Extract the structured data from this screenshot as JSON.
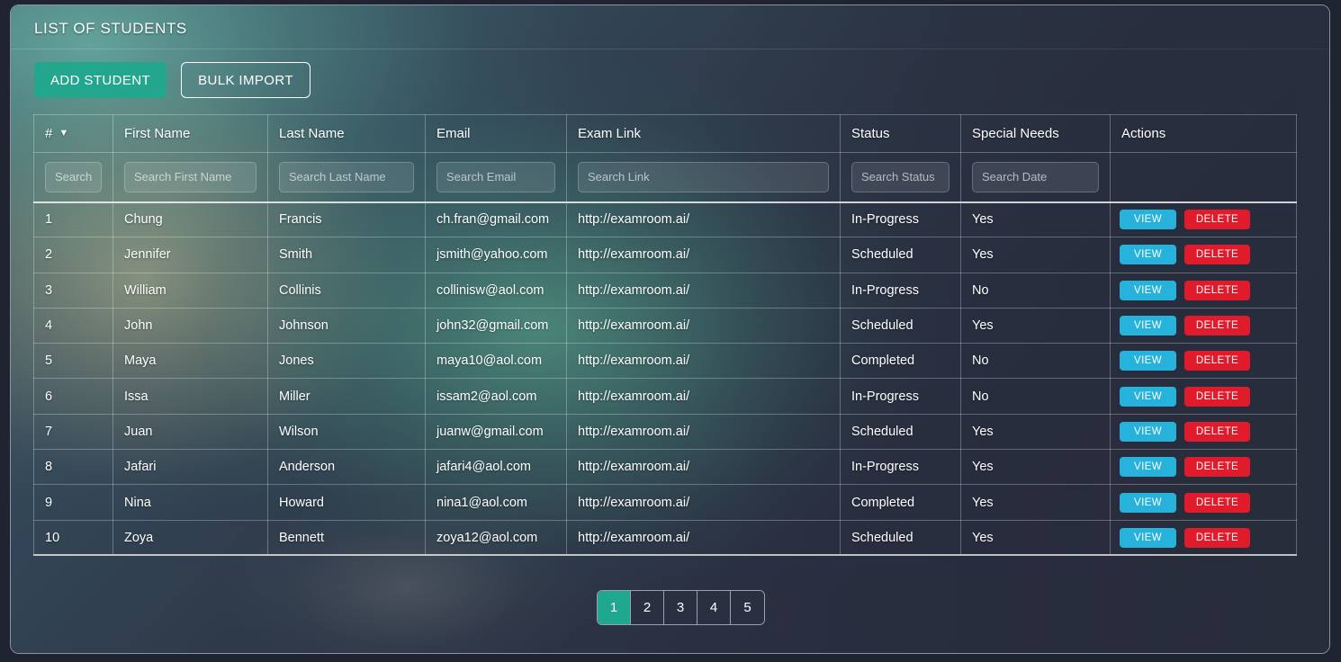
{
  "panel": {
    "title": "LIST OF STUDENTS"
  },
  "toolbar": {
    "add_student_label": "ADD STUDENT",
    "bulk_import_label": "BULK IMPORT"
  },
  "colors": {
    "primary_teal": "#22a68d",
    "view_blue": "#27b2db",
    "delete_red": "#e01b2c",
    "panel_dark": "#2b3143",
    "active_page": "#1fa78f"
  },
  "table": {
    "columns": [
      {
        "key": "num",
        "label": "#",
        "sort_icon": "chevron-down-icon",
        "sorted": true
      },
      {
        "key": "first",
        "label": "First Name"
      },
      {
        "key": "last",
        "label": "Last Name"
      },
      {
        "key": "email",
        "label": "Email"
      },
      {
        "key": "link",
        "label": "Exam Link"
      },
      {
        "key": "status",
        "label": "Status"
      },
      {
        "key": "needs",
        "label": "Special Needs"
      },
      {
        "key": "actions",
        "label": "Actions"
      }
    ],
    "search_row": [
      {
        "name": "search-num-input",
        "placeholder": "Search",
        "value": ""
      },
      {
        "name": "search-first-input",
        "placeholder": "Search First Name",
        "value": ""
      },
      {
        "name": "search-last-input",
        "placeholder": "Search Last Name",
        "value": ""
      },
      {
        "name": "search-email-input",
        "placeholder": "Search Email",
        "value": ""
      },
      {
        "name": "search-link-input",
        "placeholder": "Search Link",
        "value": ""
      },
      {
        "name": "search-status-input",
        "placeholder": "Search Status",
        "value": ""
      },
      {
        "name": "search-date-input",
        "placeholder": "Search Date",
        "value": ""
      }
    ],
    "row_actions": {
      "view_label": "VIEW",
      "delete_label": "DELETE"
    },
    "rows": [
      {
        "num": "1",
        "first": "Chung",
        "last": "Francis",
        "email": "ch.fran@gmail.com",
        "link": "http://examroom.ai/",
        "status": "In-Progress",
        "needs": "Yes"
      },
      {
        "num": "2",
        "first": "Jennifer",
        "last": "Smith",
        "email": "jsmith@yahoo.com",
        "link": "http://examroom.ai/",
        "status": "Scheduled",
        "needs": "Yes"
      },
      {
        "num": "3",
        "first": "William",
        "last": "Collinis",
        "email": "collinisw@aol.com",
        "link": "http://examroom.ai/",
        "status": "In-Progress",
        "needs": "No"
      },
      {
        "num": "4",
        "first": "John",
        "last": "Johnson",
        "email": "john32@gmail.com",
        "link": "http://examroom.ai/",
        "status": "Scheduled",
        "needs": "Yes"
      },
      {
        "num": "5",
        "first": "Maya",
        "last": "Jones",
        "email": "maya10@aol.com",
        "link": "http://examroom.ai/",
        "status": "Completed",
        "needs": "No"
      },
      {
        "num": "6",
        "first": "Issa",
        "last": "Miller",
        "email": "issam2@aol.com",
        "link": "http://examroom.ai/",
        "status": "In-Progress",
        "needs": "No"
      },
      {
        "num": "7",
        "first": "Juan",
        "last": "Wilson",
        "email": "juanw@gmail.com",
        "link": "http://examroom.ai/",
        "status": "Scheduled",
        "needs": "Yes"
      },
      {
        "num": "8",
        "first": "Jafari",
        "last": "Anderson",
        "email": "jafari4@aol.com",
        "link": "http://examroom.ai/",
        "status": "In-Progress",
        "needs": "Yes"
      },
      {
        "num": "9",
        "first": "Nina",
        "last": "Howard",
        "email": "nina1@aol.com",
        "link": "http://examroom.ai/",
        "status": "Completed",
        "needs": "Yes"
      },
      {
        "num": "10",
        "first": "Zoya",
        "last": "Bennett",
        "email": "zoya12@aol.com",
        "link": "http://examroom.ai/",
        "status": "Scheduled",
        "needs": "Yes"
      }
    ]
  },
  "pagination": {
    "pages": [
      "1",
      "2",
      "3",
      "4",
      "5"
    ],
    "active": "1"
  }
}
